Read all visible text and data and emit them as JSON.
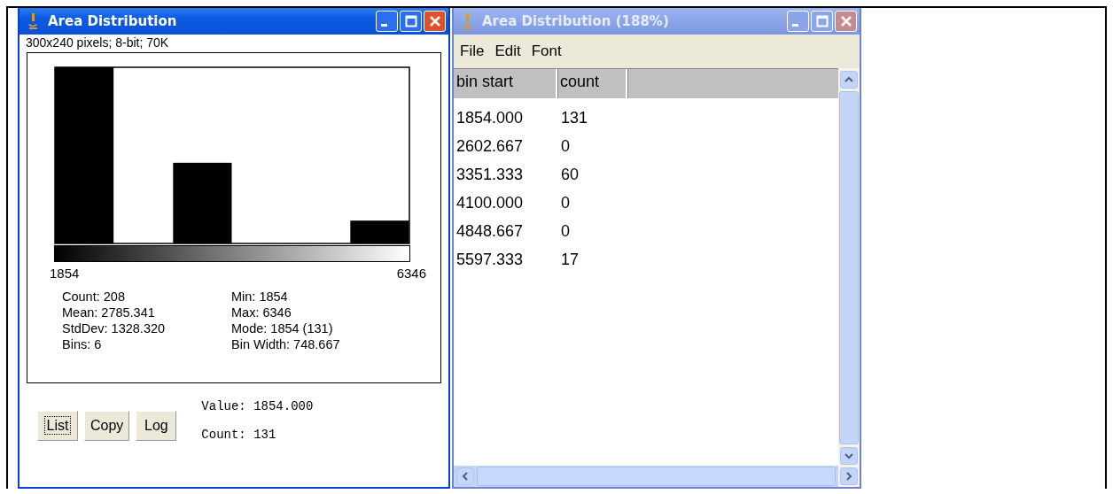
{
  "histogram_window": {
    "title": "Area Distribution",
    "active": true,
    "info": "300x240 pixels; 8-bit; 70K",
    "x_min_label": "1854",
    "x_max_label": "6346",
    "stats_left": [
      "Count: 208",
      "Mean: 2785.341",
      "StdDev: 1328.320",
      "Bins: 6"
    ],
    "stats_right": [
      "Min: 1854",
      "Max: 6346",
      "Mode: 1854 (131)",
      "Bin Width: 748.667"
    ],
    "buttons": [
      {
        "label": "List",
        "focused": true
      },
      {
        "label": "Copy",
        "focused": false
      },
      {
        "label": "Log",
        "focused": false
      }
    ],
    "value_text": "Value: 1854.000",
    "count_text": "Count: 131"
  },
  "table_window": {
    "title": "Area Distribution (188%)",
    "active": false,
    "menus": [
      "File",
      "Edit",
      "Font"
    ],
    "table": {
      "columns": [
        "bin start",
        "count"
      ],
      "rows": [
        [
          "1854.000",
          "131"
        ],
        [
          "2602.667",
          "0"
        ],
        [
          "3351.333",
          "60"
        ],
        [
          "4100.000",
          "0"
        ],
        [
          "4848.667",
          "0"
        ],
        [
          "5597.333",
          "17"
        ]
      ]
    }
  }
}
